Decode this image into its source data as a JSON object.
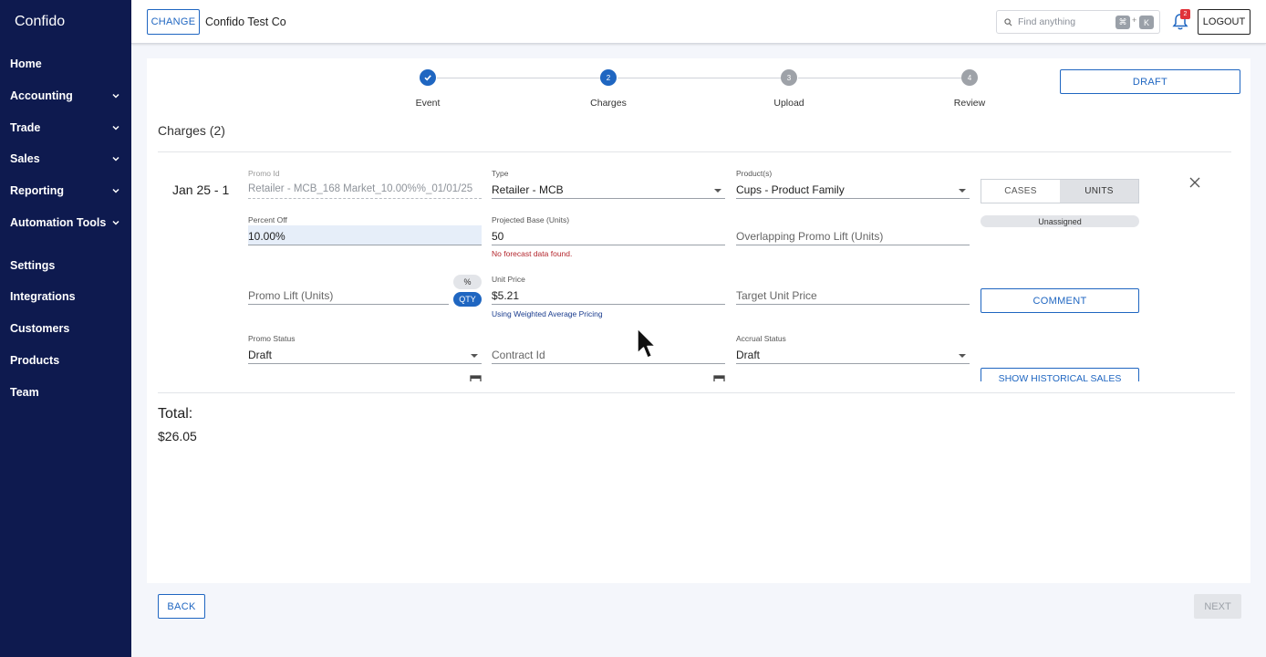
{
  "sidebar": {
    "brand": "Confido",
    "items": [
      {
        "label": "Home",
        "has_children": false
      },
      {
        "label": "Accounting",
        "has_children": true
      },
      {
        "label": "Trade",
        "has_children": true
      },
      {
        "label": "Sales",
        "has_children": true
      },
      {
        "label": "Reporting",
        "has_children": true
      },
      {
        "label": "Automation Tools",
        "has_children": true
      },
      {
        "label": "Settings",
        "has_children": false
      },
      {
        "label": "Integrations",
        "has_children": false
      },
      {
        "label": "Customers",
        "has_children": false
      },
      {
        "label": "Products",
        "has_children": false
      },
      {
        "label": "Team",
        "has_children": false
      }
    ]
  },
  "topbar": {
    "change_label": "CHANGE",
    "company": "Confido Test Co",
    "search_placeholder": "Find anything",
    "shortcut_key1": "⌘",
    "shortcut_plus": "+",
    "shortcut_key2": "K",
    "notification_count": "2",
    "logout_label": "LOGOUT"
  },
  "stepper": {
    "steps": [
      {
        "number": "✓",
        "label": "Event",
        "state": "done"
      },
      {
        "number": "2",
        "label": "Charges",
        "state": "active"
      },
      {
        "number": "3",
        "label": "Upload",
        "state": "pending"
      },
      {
        "number": "4",
        "label": "Review",
        "state": "pending"
      }
    ],
    "draft_label": "DRAFT"
  },
  "charges": {
    "title": "Charges (2)",
    "date_label": "Jan 25 - 1",
    "promo_id": {
      "label": "Promo Id",
      "value": "Retailer - MCB_168 Market_10.00%%_01/01/25"
    },
    "type": {
      "label": "Type",
      "value": "Retailer - MCB"
    },
    "products": {
      "label": "Product(s)",
      "value": "Cups - Product Family"
    },
    "unit_toggle": {
      "cases": "CASES",
      "units": "UNITS",
      "selected": "UNITS"
    },
    "assignee": "Unassigned",
    "percent_off": {
      "label": "Percent Off",
      "value": "10.00%"
    },
    "projected_base": {
      "label": "Projected Base (Units)",
      "value": "50",
      "error": "No forecast data found."
    },
    "overlapping_lift": {
      "placeholder": "Overlapping Promo Lift (Units)"
    },
    "promo_lift": {
      "placeholder": "Promo Lift (Units)",
      "pct_label": "%",
      "qty_label": "QTY"
    },
    "unit_price": {
      "label": "Unit Price",
      "value": "$5.21",
      "helper": "Using Weighted Average Pricing"
    },
    "target_unit_price": {
      "placeholder": "Target Unit Price"
    },
    "comment_label": "COMMENT",
    "promo_status": {
      "label": "Promo Status",
      "value": "Draft"
    },
    "contract_id": {
      "placeholder": "Contract Id"
    },
    "accrual_status": {
      "label": "Accrual Status",
      "value": "Draft"
    },
    "historical_sales_label": "SHOW HISTORICAL SALES"
  },
  "total": {
    "label": "Total:",
    "value": "$26.05"
  },
  "footer": {
    "back_label": "BACK",
    "next_label": "NEXT"
  },
  "colors": {
    "sidebar": "#0e1a4f",
    "accent": "#1f66c1",
    "error": "#b3262d"
  }
}
